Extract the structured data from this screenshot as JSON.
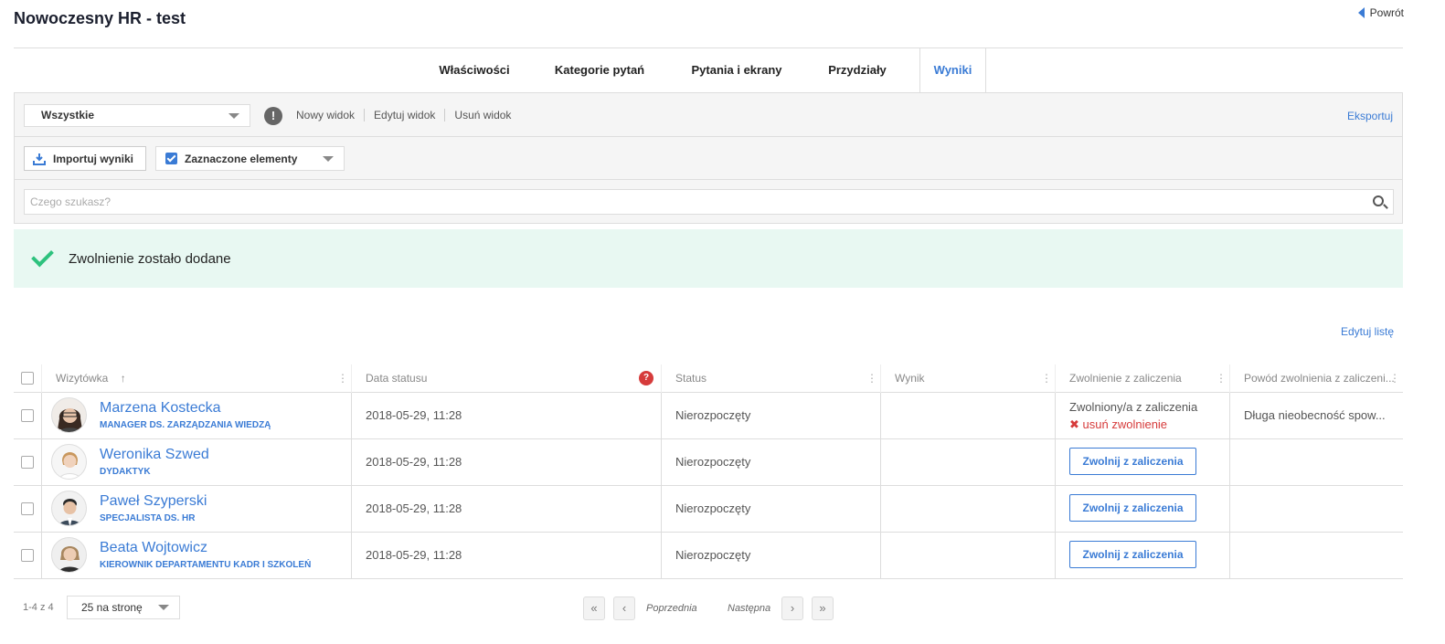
{
  "header": {
    "title": "Nowoczesny HR - test",
    "back_label": "Powrót"
  },
  "tabs": [
    {
      "label": "Właściwości"
    },
    {
      "label": "Kategorie pytań"
    },
    {
      "label": "Pytania i ekrany"
    },
    {
      "label": "Przydziały"
    },
    {
      "label": "Wyniki",
      "active": true
    }
  ],
  "toolbar": {
    "view_select_value": "Wszystkie",
    "view_links": [
      "Nowy widok",
      "Edytuj widok",
      "Usuń widok"
    ],
    "export_label": "Eksportuj",
    "import_label": "Importuj wyniki",
    "selected_label": "Zaznaczone elementy",
    "search_placeholder": "Czego szukasz?"
  },
  "alert": {
    "message": "Zwolnienie zostało dodane"
  },
  "edit_list_label": "Edytuj listę",
  "table": {
    "columns": [
      "Wizytówka",
      "Data statusu",
      "Status",
      "Wynik",
      "Zwolnienie z zaliczenia",
      "Powód zwolnienia z zaliczeni..."
    ],
    "sort_indicator": "↑",
    "exempt_button_label": "Zwolnij z zaliczenia",
    "rows": [
      {
        "name": "Marzena Kostecka",
        "title": "MANAGER DS. ZARZĄDZANIA WIEDZĄ",
        "date": "2018-05-29, 11:28",
        "status": "Nierozpoczęty",
        "score": "",
        "exempt": "Zwolniony/a z zaliczenia",
        "remove_exempt": "usuń zwolnienie",
        "reason": "Długa nieobecność spow..."
      },
      {
        "name": "Weronika Szwed",
        "title": "DYDAKTYK",
        "date": "2018-05-29, 11:28",
        "status": "Nierozpoczęty",
        "score": ""
      },
      {
        "name": "Paweł Szyperski",
        "title": "SPECJALISTA DS. HR",
        "date": "2018-05-29, 11:28",
        "status": "Nierozpoczęty",
        "score": ""
      },
      {
        "name": "Beata Wojtowicz",
        "title": "KIEROWNIK DEPARTAMENTU KADR I SZKOLEŃ",
        "date": "2018-05-29, 11:28",
        "status": "Nierozpoczęty",
        "score": ""
      }
    ]
  },
  "pagination": {
    "range": "1-4 z 4",
    "per_page_value": "25 na stronę",
    "prev_label": "Poprzednia",
    "next_label": "Następna"
  },
  "colors": {
    "accent": "#3a7bd5",
    "success": "#2ec27e",
    "danger": "#d63b3b",
    "alert_bg": "#e8f8f2"
  }
}
